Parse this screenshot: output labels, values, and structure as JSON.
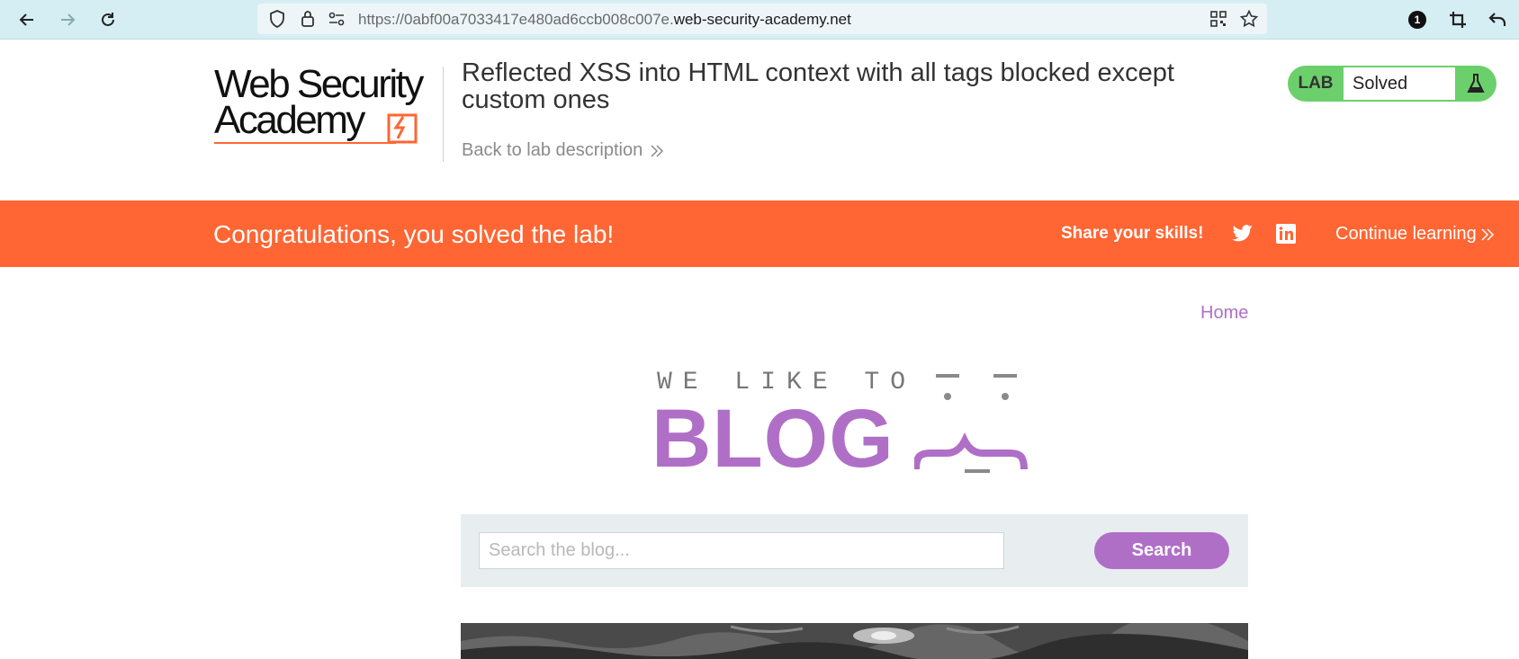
{
  "browser": {
    "url_prefix": "https://0abf00a7033417e480ad6ccb008c007e.",
    "url_domain": "web-security-academy.net",
    "icons": [
      "back-arrow-icon",
      "forward-arrow-icon",
      "reload-icon",
      "shield-icon",
      "lock-icon",
      "site-permissions-icon",
      "qr-code-icon",
      "star-icon",
      "extension-badge-icon",
      "crop-icon",
      "undo-icon"
    ],
    "badge_count": "1"
  },
  "lab_header": {
    "logo_line1": "Web Security",
    "logo_line2": "Academy",
    "title": "Reflected XSS into HTML context with all tags blocked except custom ones",
    "back_link": "Back to lab description",
    "status_label": "LAB",
    "status_value": "Solved"
  },
  "banner": {
    "message": "Congratulations, you solved the lab!",
    "share_text": "Share your skills!",
    "continue_link": "Continue learning",
    "background": "#ff6633"
  },
  "blog": {
    "home_link": "Home",
    "logo_top": "WE LIKE TO",
    "logo_big": "BLOG",
    "search_placeholder": "Search the blog...",
    "search_button": "Search",
    "accent": "#b06fc7"
  }
}
